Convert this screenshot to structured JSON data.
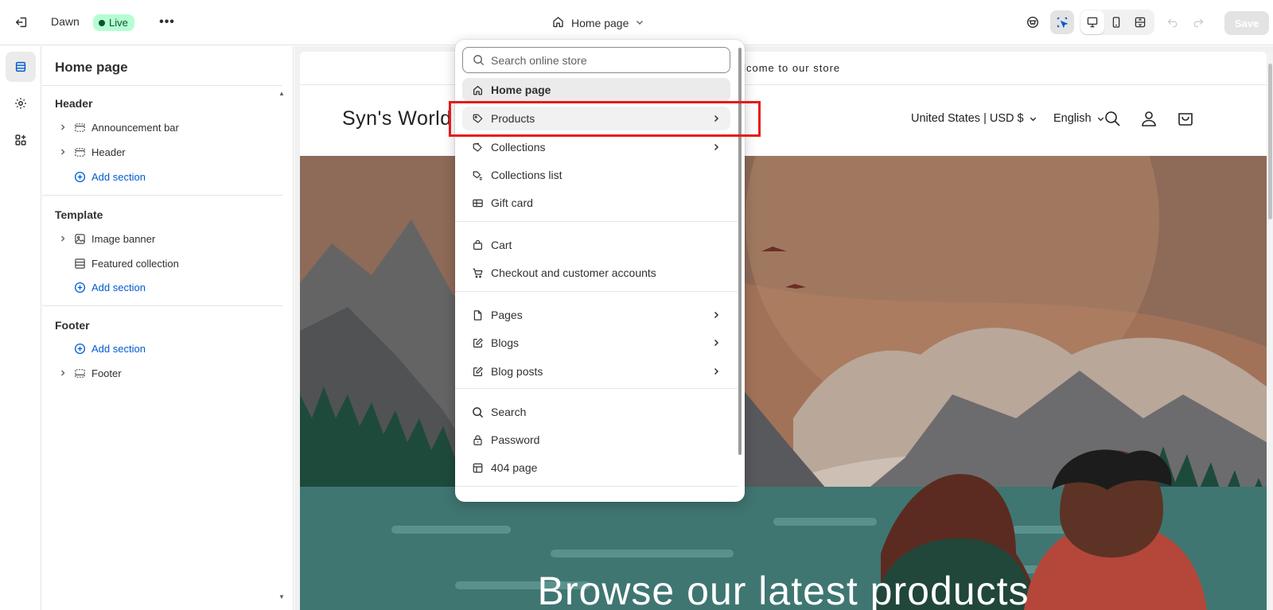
{
  "topbar": {
    "theme_name": "Dawn",
    "status_badge": "Live",
    "more": "•••",
    "page_selector": "Home page",
    "save_label": "Save"
  },
  "sidebar": {
    "title": "Home page",
    "groups": [
      {
        "title": "Header",
        "items": [
          {
            "label": "Announcement bar",
            "icon": "section-icon"
          },
          {
            "label": "Header",
            "icon": "section-icon"
          }
        ],
        "add": "Add section"
      },
      {
        "title": "Template",
        "items": [
          {
            "label": "Image banner",
            "icon": "image-icon"
          },
          {
            "label": "Featured collection",
            "icon": "collection-icon"
          }
        ],
        "add": "Add section"
      },
      {
        "title": "Footer",
        "add": "Add section",
        "items": [
          {
            "label": "Footer",
            "icon": "footer-icon"
          }
        ]
      }
    ]
  },
  "dropdown": {
    "search_placeholder": "Search online store",
    "items": [
      {
        "label": "Home page",
        "icon": "home-icon"
      },
      {
        "label": "Products",
        "icon": "tag-icon"
      },
      {
        "label": "Collections",
        "icon": "collection-icon"
      },
      {
        "label": "Collections list",
        "icon": "collection-list-icon"
      },
      {
        "label": "Gift card",
        "icon": "gift-card-icon"
      },
      {
        "label": "Cart",
        "icon": "bag-icon"
      },
      {
        "label": "Checkout and customer accounts",
        "icon": "cart-icon"
      },
      {
        "label": "Pages",
        "icon": "page-icon"
      },
      {
        "label": "Blogs",
        "icon": "blog-icon"
      },
      {
        "label": "Blog posts",
        "icon": "blog-post-icon"
      },
      {
        "label": "Search",
        "icon": "search-icon"
      },
      {
        "label": "Password",
        "icon": "lock-icon"
      },
      {
        "label": "404 page",
        "icon": "layout-icon"
      }
    ]
  },
  "preview": {
    "announcement": "Welcome to our store",
    "logo": "Syn's World",
    "localization": "United States | USD $",
    "language": "English",
    "hero_heading": "Browse our latest products"
  },
  "colors": {
    "accent_link": "#005bd3",
    "live_badge_bg": "#b4fed2",
    "highlight_box": "#e51a1a"
  }
}
